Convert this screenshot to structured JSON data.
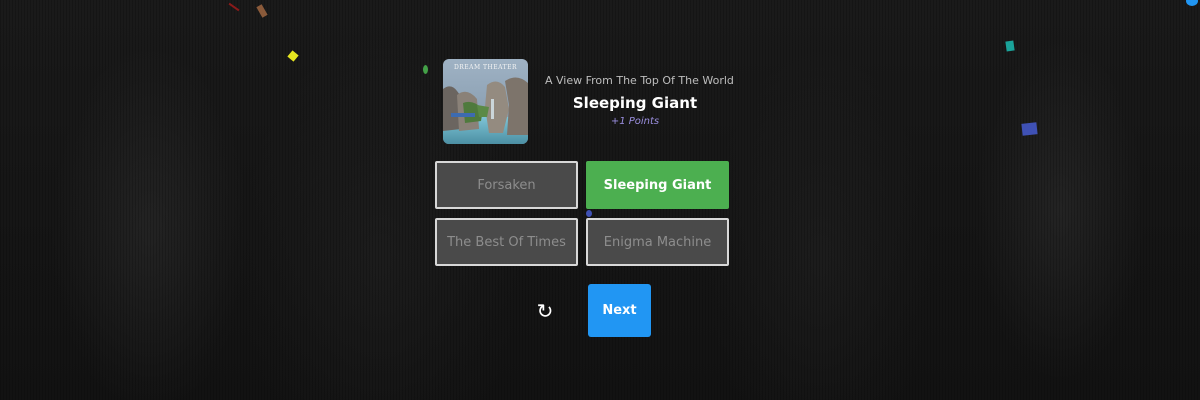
{
  "now_playing": {
    "album": "A View From The Top Of The World",
    "title": "Sleeping Giant",
    "points": "+1 Points",
    "album_art_text": "DREAM THEATER"
  },
  "choices": [
    {
      "label": "Forsaken",
      "state": "unselected"
    },
    {
      "label": "Sleeping Giant",
      "state": "correct"
    },
    {
      "label": "The Best Of Times",
      "state": "unselected"
    },
    {
      "label": "Enigma Machine",
      "state": "unselected"
    }
  ],
  "controls": {
    "retry_icon": "↻",
    "next_label": "Next"
  },
  "colors": {
    "correct": "#4caf50",
    "next_button": "#2196f3",
    "points_text": "#9b8fe0",
    "choice_bg": "#4a4a4a"
  }
}
